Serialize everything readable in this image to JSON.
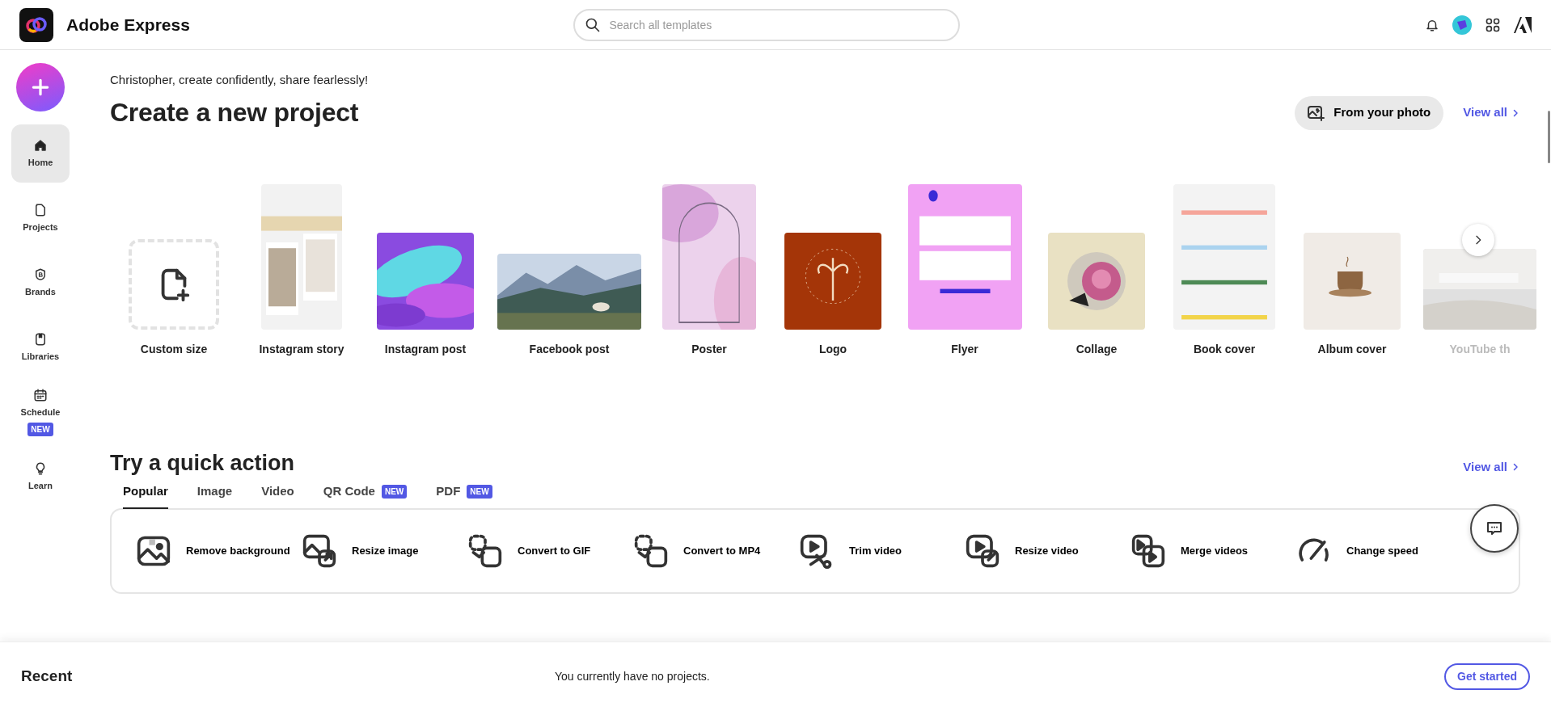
{
  "header": {
    "brand": "Adobe Express",
    "search": {
      "placeholder": "Search all templates"
    }
  },
  "sidebar": {
    "items": [
      {
        "label": "Home",
        "selected": true
      },
      {
        "label": "Projects",
        "selected": false
      },
      {
        "label": "Brands",
        "selected": false
      },
      {
        "label": "Libraries",
        "selected": false
      },
      {
        "label": "Schedule",
        "selected": false,
        "badge": "NEW"
      },
      {
        "label": "Learn",
        "selected": false
      }
    ]
  },
  "greeting": "Christopher, create confidently, share fearlessly!",
  "create": {
    "title": "Create a new project",
    "from_photo": "From your photo",
    "view_all": "View all",
    "templates": [
      {
        "label": "Custom size",
        "kind": "custom",
        "faded": false
      },
      {
        "label": "Instagram story",
        "kind": "story",
        "faded": false
      },
      {
        "label": "Instagram post",
        "kind": "square",
        "faded": false
      },
      {
        "label": "Facebook post",
        "kind": "landscape",
        "faded": false
      },
      {
        "label": "Poster",
        "kind": "poster",
        "faded": false
      },
      {
        "label": "Logo",
        "kind": "square",
        "faded": false
      },
      {
        "label": "Flyer",
        "kind": "flyer",
        "faded": false
      },
      {
        "label": "Collage",
        "kind": "square",
        "faded": false
      },
      {
        "label": "Book cover",
        "kind": "book",
        "faded": false
      },
      {
        "label": "Album cover",
        "kind": "square",
        "faded": false
      },
      {
        "label": "YouTube th",
        "kind": "wide",
        "faded": true
      }
    ]
  },
  "quick": {
    "title": "Try a quick action",
    "view_all": "View all",
    "tabs": [
      {
        "label": "Popular",
        "selected": true
      },
      {
        "label": "Image",
        "selected": false
      },
      {
        "label": "Video",
        "selected": false
      },
      {
        "label": "QR Code",
        "selected": false,
        "badge": "NEW"
      },
      {
        "label": "PDF",
        "selected": false,
        "badge": "NEW"
      }
    ],
    "actions": [
      {
        "label": "Remove background"
      },
      {
        "label": "Resize image"
      },
      {
        "label": "Convert to GIF"
      },
      {
        "label": "Convert to MP4"
      },
      {
        "label": "Trim video"
      },
      {
        "label": "Resize video"
      },
      {
        "label": "Merge videos"
      },
      {
        "label": "Change speed"
      }
    ]
  },
  "recent": {
    "title": "Recent",
    "message": "You currently have no projects.",
    "button": "Get started"
  }
}
